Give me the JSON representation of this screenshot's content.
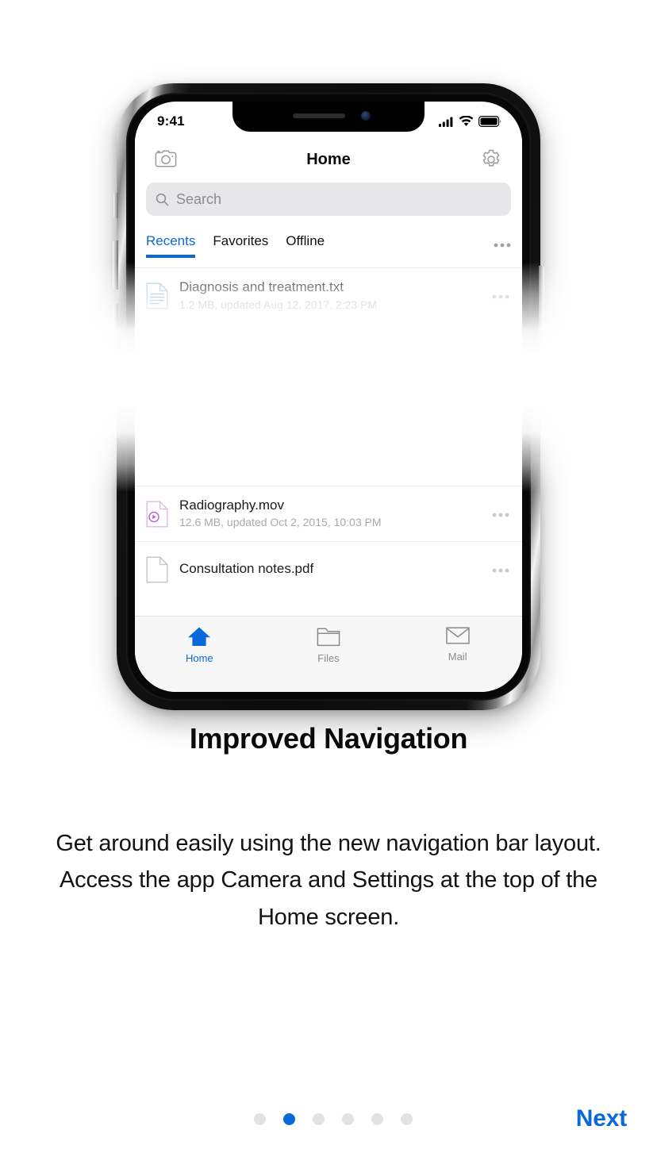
{
  "onboarding": {
    "headline": "Improved Navigation",
    "body": "Get around easily using the new navigation bar layout. Access the app Camera and Settings at the top of the Home screen.",
    "next_label": "Next",
    "accent_color": "#0a68d8",
    "dots": {
      "count": 6,
      "active_index": 1
    }
  },
  "phone": {
    "status_bar": {
      "time": "9:41",
      "signal_icon": "cellular-signal-icon",
      "wifi_icon": "wifi-icon",
      "battery_icon": "battery-full-icon"
    },
    "nav_bar": {
      "title": "Home",
      "left_icon": "camera-icon",
      "right_icon": "gear-icon"
    },
    "search": {
      "placeholder": "Search",
      "icon": "search-icon",
      "value": ""
    },
    "tabs": [
      {
        "label": "Recents",
        "active": true
      },
      {
        "label": "Favorites",
        "active": false
      },
      {
        "label": "Offline",
        "active": false
      }
    ],
    "tabs_more_icon": "ellipsis-icon",
    "files": [
      {
        "name": "Diagnosis and treatment.txt",
        "subtitle": "1.2 MB, updated Aug 12, 2017, 2:23 PM",
        "icon": "text-document-icon",
        "icon_color": "#7aa7d6",
        "more_icon": "ellipsis-icon"
      },
      {
        "name": "Radiography.mov",
        "subtitle": "12.6 MB, updated Oct 2, 2015, 10:03 PM",
        "icon": "video-document-icon",
        "icon_color": "#b66ad0",
        "more_icon": "ellipsis-icon"
      },
      {
        "name": "Consultation notes.pdf",
        "subtitle": "",
        "icon": "pdf-document-icon",
        "icon_color": "#b9b9bd",
        "more_icon": "ellipsis-icon"
      }
    ],
    "tab_bar": [
      {
        "label": "Home",
        "icon": "home-icon",
        "active": true
      },
      {
        "label": "Files",
        "icon": "folder-icon",
        "active": false
      },
      {
        "label": "Mail",
        "icon": "envelope-icon",
        "active": false
      }
    ]
  }
}
